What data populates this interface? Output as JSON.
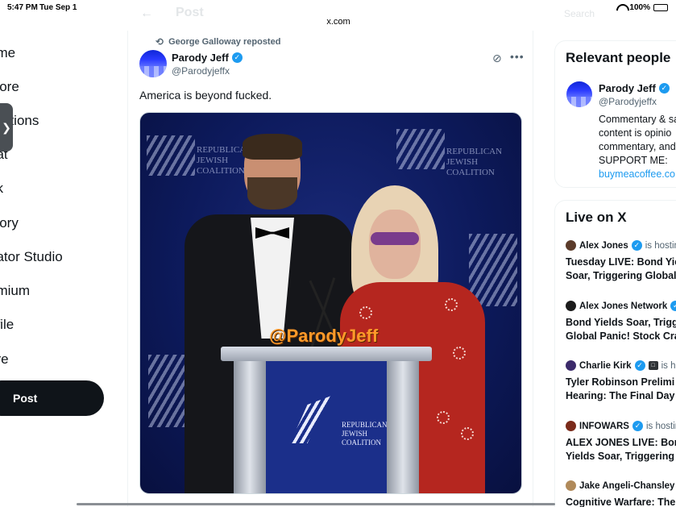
{
  "status_bar": {
    "time": "5:47 PM",
    "date": "Tue Sep 1",
    "battery": "100%"
  },
  "browser": {
    "url": "x.com"
  },
  "header": {
    "back_glyph": "←",
    "title": "Post",
    "search_placeholder": "Search"
  },
  "nav": {
    "items": [
      {
        "label": "ome"
      },
      {
        "label": "plore"
      },
      {
        "label": "fications"
      },
      {
        "label": "hat"
      },
      {
        "label": "ok"
      },
      {
        "label": "story"
      },
      {
        "label": "eator Studio"
      },
      {
        "label": "emium"
      },
      {
        "label": "ofile"
      },
      {
        "label": "ore"
      }
    ],
    "handle_glyph": "❯",
    "post_button": "Post"
  },
  "tweet": {
    "reposted_by": "George Galloway reposted",
    "author_name": "Parody Jeff",
    "author_handle": "@Parodyjeffx",
    "text": "America is beyond fucked.",
    "media": {
      "watermark": "@ParodyJeff",
      "backdrop_lines": [
        "REPUBLICAN",
        "JEWISH",
        "COALITION"
      ],
      "podium_lines": [
        "REPUBLICAN",
        "JEWISH",
        "COALITION"
      ]
    }
  },
  "relevant_people": {
    "title": "Relevant people",
    "person": {
      "name": "Parody Jeff",
      "handle": "@Parodyjeffx",
      "bio_lines": [
        "Commentary & sa",
        "content is opinio",
        "commentary, and",
        "SUPPORT ME:"
      ],
      "link": "buymeacoffee.co"
    }
  },
  "live_on_x": {
    "title": "Live on X",
    "items": [
      {
        "host": "Alex Jones",
        "status": "is hosting",
        "title_lines": [
          "Tuesday LIVE: Bond Yie",
          "Soar, Triggering Global"
        ]
      },
      {
        "host": "Alex Jones Network",
        "status": "",
        "title_lines": [
          "Bond Yields Soar, Trigg",
          "Global Panic! Stock Cra"
        ]
      },
      {
        "host": "Charlie Kirk",
        "status": "is ho",
        "title_lines": [
          "Tyler Robinson Prelimi",
          "Hearing: The Final Day"
        ]
      },
      {
        "host": "INFOWARS",
        "status": "is hostin",
        "title_lines": [
          "ALEX JONES LIVE: Bond",
          "Yields Soar, Triggering"
        ]
      },
      {
        "host": "Jake Angeli-Chansley",
        "status": "",
        "title_lines": [
          "Cognitive Warfare: The"
        ]
      }
    ]
  },
  "colors": {
    "accent": "#1d9bf0",
    "text": "#0f1419",
    "muted": "#536471",
    "post_button_bg": "#0f1419",
    "watermark": "#ff9a2a"
  }
}
